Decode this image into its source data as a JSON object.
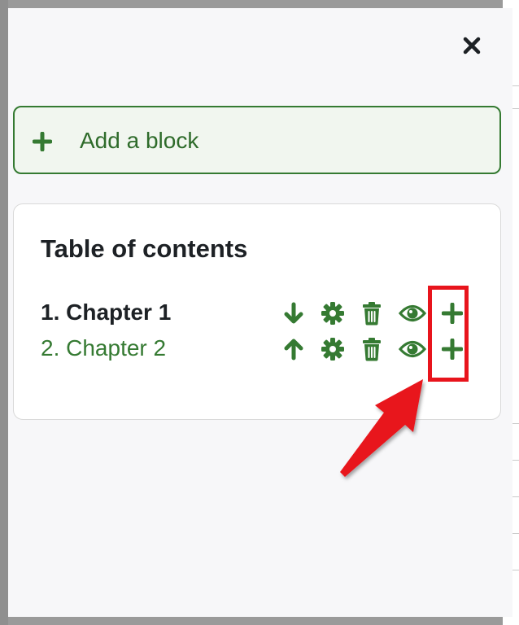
{
  "drawer": {
    "close_icon": "close-icon",
    "add_block": {
      "label": "Add a block",
      "icon": "plus-icon"
    }
  },
  "toc": {
    "title": "Table of contents",
    "chapters": [
      {
        "label": "1. Chapter 1",
        "state": "current",
        "icons": [
          "arrow-down-icon",
          "gear-icon",
          "trash-icon",
          "eye-icon",
          "plus-icon"
        ]
      },
      {
        "label": "2. Chapter 2",
        "state": "link",
        "icons": [
          "arrow-up-icon",
          "gear-icon",
          "trash-icon",
          "eye-icon",
          "plus-icon"
        ]
      }
    ]
  },
  "colors": {
    "accent_green": "#357a32",
    "annotation_red": "#e8141c",
    "text_dark": "#1d2125",
    "drawer_bg": "#f7f7f9"
  }
}
